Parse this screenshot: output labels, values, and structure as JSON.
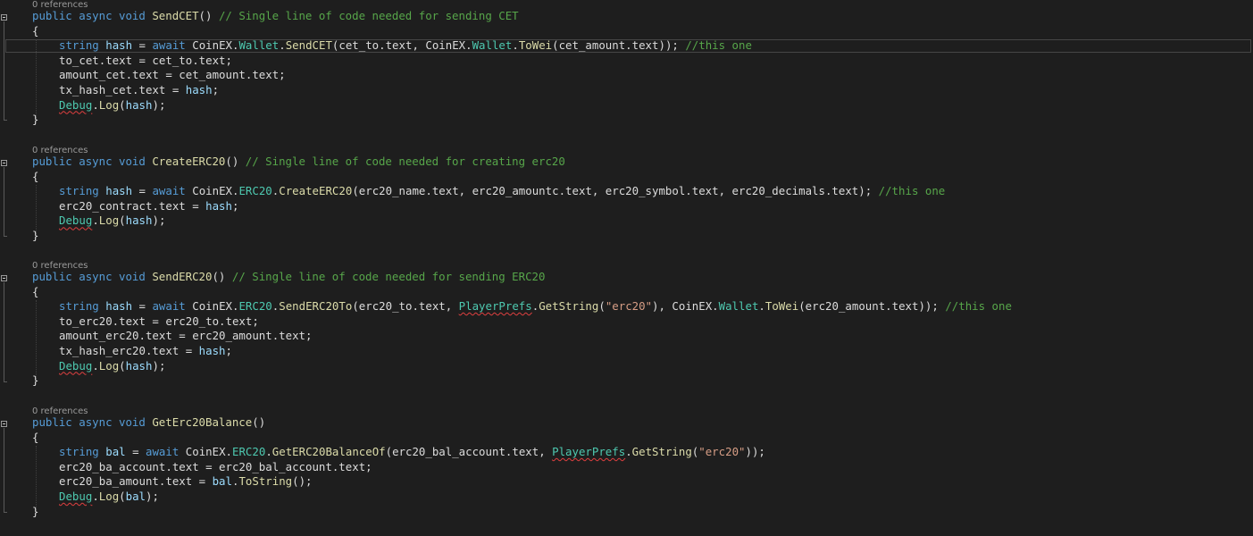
{
  "codelens": "0 references",
  "methods": [
    {
      "header": {
        "public": "public",
        "async": "async",
        "void": "void",
        "name": "SendCET",
        "parens": "()",
        "comment": "// Single line of code needed for sending CET"
      },
      "open": "{",
      "close": "}",
      "body": [
        [
          [
            "kw",
            "string"
          ],
          [
            "id",
            " "
          ],
          [
            "prop",
            "hash"
          ],
          [
            "id",
            " = "
          ],
          [
            "kw",
            "await"
          ],
          [
            "id",
            " CoinEX."
          ],
          [
            "cls",
            "Wallet"
          ],
          [
            "id",
            "."
          ],
          [
            "mth",
            "SendCET"
          ],
          [
            "id",
            "(cet_to.text, CoinEX."
          ],
          [
            "cls",
            "Wallet"
          ],
          [
            "id",
            "."
          ],
          [
            "mth",
            "ToWei"
          ],
          [
            "id",
            "(cet_amount.text)); "
          ],
          [
            "cmt",
            "//this one"
          ]
        ],
        [
          [
            "id",
            "to_cet.text = cet_to.text;"
          ]
        ],
        [
          [
            "id",
            "amount_cet.text = cet_amount.text;"
          ]
        ],
        [
          [
            "id",
            "tx_hash_cet.text = "
          ],
          [
            "prop",
            "hash"
          ],
          [
            "id",
            ";"
          ]
        ],
        [
          [
            "cls squig",
            "Debug"
          ],
          [
            "id",
            "."
          ],
          [
            "mth",
            "Log"
          ],
          [
            "id",
            "("
          ],
          [
            "prop",
            "hash"
          ],
          [
            "id",
            ");"
          ]
        ]
      ]
    },
    {
      "header": {
        "public": "public",
        "async": "async",
        "void": "void",
        "name": "CreateERC20",
        "parens": "()",
        "comment": "// Single line of code needed for creating erc20"
      },
      "open": "{",
      "close": "}",
      "body": [
        [
          [
            "kw",
            "string"
          ],
          [
            "id",
            " "
          ],
          [
            "prop",
            "hash"
          ],
          [
            "id",
            " = "
          ],
          [
            "kw",
            "await"
          ],
          [
            "id",
            " CoinEX."
          ],
          [
            "cls",
            "ERC20"
          ],
          [
            "id",
            "."
          ],
          [
            "mth",
            "CreateERC20"
          ],
          [
            "id",
            "(erc20_name.text, erc20_amountc.text, erc20_symbol.text, erc20_decimals.text); "
          ],
          [
            "cmt",
            "//this one"
          ]
        ],
        [
          [
            "id",
            "erc20_contract.text = "
          ],
          [
            "prop",
            "hash"
          ],
          [
            "id",
            ";"
          ]
        ],
        [
          [
            "cls squig",
            "Debug"
          ],
          [
            "id",
            "."
          ],
          [
            "mth",
            "Log"
          ],
          [
            "id",
            "("
          ],
          [
            "prop",
            "hash"
          ],
          [
            "id",
            ");"
          ]
        ]
      ]
    },
    {
      "header": {
        "public": "public",
        "async": "async",
        "void": "void",
        "name": "SendERC20",
        "parens": "()",
        "comment": "// Single line of code needed for sending ERC20"
      },
      "open": "{",
      "close": "}",
      "body": [
        [
          [
            "kw",
            "string"
          ],
          [
            "id",
            " "
          ],
          [
            "prop",
            "hash"
          ],
          [
            "id",
            " = "
          ],
          [
            "kw",
            "await"
          ],
          [
            "id",
            " CoinEX."
          ],
          [
            "cls",
            "ERC20"
          ],
          [
            "id",
            "."
          ],
          [
            "mth",
            "SendERC20To"
          ],
          [
            "id",
            "(erc20_to.text, "
          ],
          [
            "cls squig",
            "PlayerPrefs"
          ],
          [
            "id",
            "."
          ],
          [
            "mth",
            "GetString"
          ],
          [
            "id",
            "("
          ],
          [
            "str",
            "\"erc20\""
          ],
          [
            "id",
            "), CoinEX."
          ],
          [
            "cls",
            "Wallet"
          ],
          [
            "id",
            "."
          ],
          [
            "mth",
            "ToWei"
          ],
          [
            "id",
            "(erc20_amount.text)); "
          ],
          [
            "cmt",
            "//this one"
          ]
        ],
        [
          [
            "id",
            "to_erc20.text = erc20_to.text;"
          ]
        ],
        [
          [
            "id",
            "amount_erc20.text = erc20_amount.text;"
          ]
        ],
        [
          [
            "id",
            "tx_hash_erc20.text = "
          ],
          [
            "prop",
            "hash"
          ],
          [
            "id",
            ";"
          ]
        ],
        [
          [
            "cls squig",
            "Debug"
          ],
          [
            "id",
            "."
          ],
          [
            "mth",
            "Log"
          ],
          [
            "id",
            "("
          ],
          [
            "prop",
            "hash"
          ],
          [
            "id",
            ");"
          ]
        ]
      ]
    },
    {
      "header": {
        "public": "public",
        "async": "async",
        "void": "void",
        "name": "GetErc20Balance",
        "parens": "()",
        "comment": ""
      },
      "open": "{",
      "close": "}",
      "body": [
        [
          [
            "kw",
            "string"
          ],
          [
            "id",
            " "
          ],
          [
            "prop",
            "bal"
          ],
          [
            "id",
            " = "
          ],
          [
            "kw",
            "await"
          ],
          [
            "id",
            " CoinEX."
          ],
          [
            "cls",
            "ERC20"
          ],
          [
            "id",
            "."
          ],
          [
            "mth",
            "GetERC20BalanceOf"
          ],
          [
            "id",
            "(erc20_bal_account.text, "
          ],
          [
            "cls squig",
            "PlayerPrefs"
          ],
          [
            "id",
            "."
          ],
          [
            "mth",
            "GetString"
          ],
          [
            "id",
            "("
          ],
          [
            "str",
            "\"erc20\""
          ],
          [
            "id",
            "));"
          ]
        ],
        [
          [
            "id",
            "erc20_ba_account.text = erc20_bal_account.text;"
          ]
        ],
        [
          [
            "id",
            "erc20_ba_amount.text = "
          ],
          [
            "prop",
            "bal"
          ],
          [
            "id",
            "."
          ],
          [
            "mth",
            "ToString"
          ],
          [
            "id",
            "();"
          ]
        ],
        [
          [
            "cls squig",
            "Debug"
          ],
          [
            "id",
            "."
          ],
          [
            "mth",
            "Log"
          ],
          [
            "id",
            "("
          ],
          [
            "prop",
            "bal"
          ],
          [
            "id",
            ");"
          ]
        ]
      ]
    }
  ]
}
